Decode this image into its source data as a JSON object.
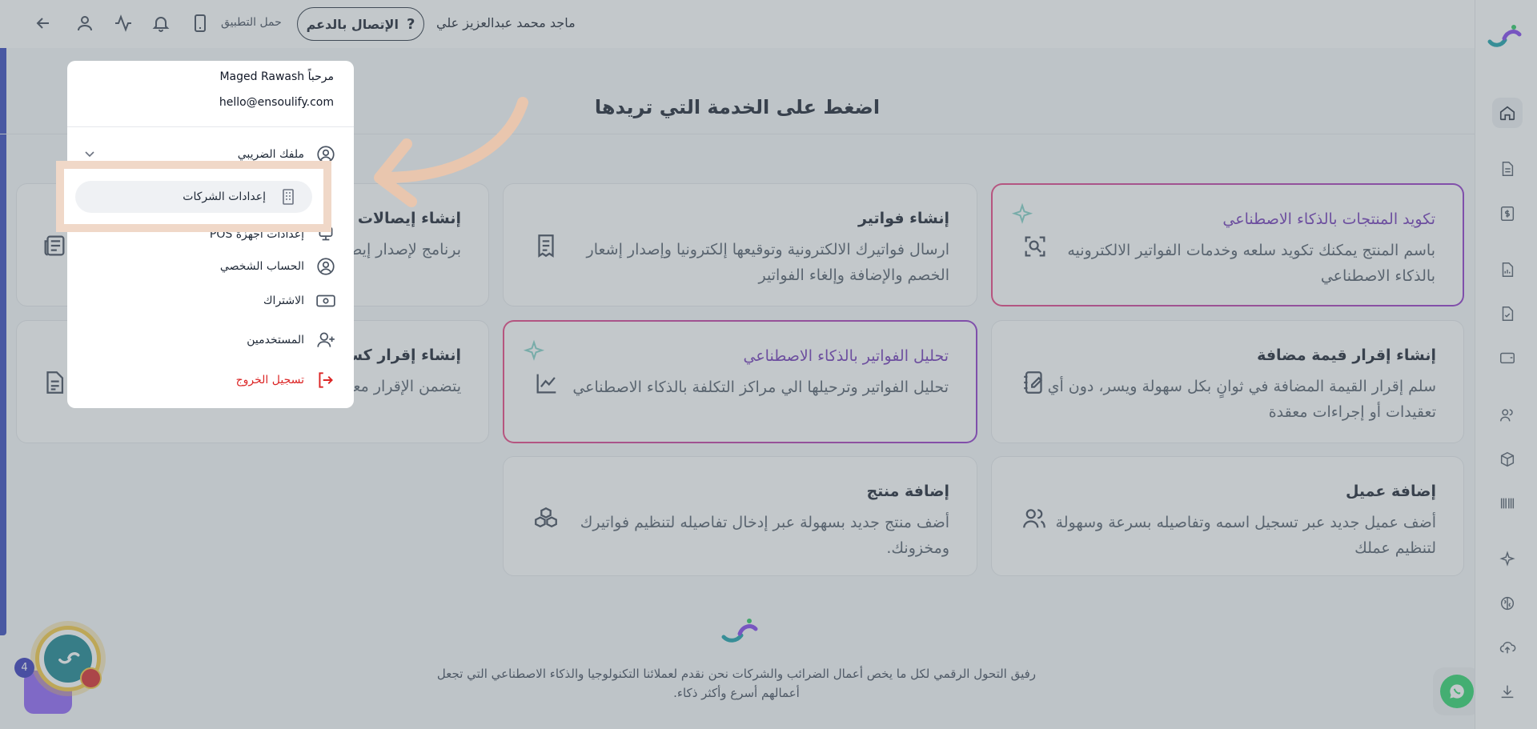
{
  "header": {
    "user_name": "ماجد محمد عبدالعزيز علي",
    "support_label": "الإتصال بالدعم",
    "download_app_label": "حمل التطبيق"
  },
  "page_title": "اضغط على الخدمة التي تريدها",
  "cards": [
    {
      "title": "تكويد المنتجات بالذكاء الاصطناعي",
      "desc": "باسم المنتج يمكنك تكويد سلعه وخدمات الفواتير الالكترونيه بالذكاء الاصطناعي"
    },
    {
      "title": "إنشاء فواتير",
      "desc": "ارسال فواتيرك الالكترونية وتوقيعها إلكترونيا وإصدار إشعار الخصم والإضافة وإلغاء الفواتير"
    },
    {
      "title": "إنشاء إيصالات",
      "desc": "برنامج لإصدار إيصالات عملائك تتبع المدفوعات"
    },
    {
      "title": "إنشاء إقرار قيمة مضافة",
      "desc": "سلم إقرار القيمة المضافة في ثوانٍ بكل سهولة ويسر، دون أي تعقيدات أو إجراءات معقدة"
    },
    {
      "title": "تحليل الفواتير بالذكاء الاصطناعي",
      "desc": "تحليل الفواتير وترحيلها الي مراكز التكلفة بالذكاء الاصطناعي"
    },
    {
      "title": "إنشاء إقرار كسب العمل",
      "desc": "يتضمن الإقرار معلومات كسبه"
    },
    {
      "title": "إضافة عميل",
      "desc": "أضف عميل جديد عبر تسجيل اسمه وتفاصيله بسرعة وسهولة لتنظيم عملك"
    },
    {
      "title": "إضافة منتج",
      "desc": "أضف منتج جديد بسهولة عبر إدخال تفاصيله لتنظيم فواتيرك ومخزونك."
    }
  ],
  "footer": {
    "text": "رفيق التحول الرقمي لكل ما يخص أعمال الضرائب والشركات نحن نقدم لعملائنا التكنولوجيا والذكاء الاصطناعي التي تجعل أعمالهم أسرع وأكثر ذكاء."
  },
  "menu": {
    "greeting": "مرحباً Maged Rawash",
    "email": "hello@ensoulify.com",
    "tax_profile_label": "ملفك الضريبي",
    "companies_settings_label": "إعدادات الشركات",
    "pos_settings_label": "إعدادات أجهزة POS",
    "personal_account_label": "الحساب الشخصي",
    "subscription_label": "الاشتراك",
    "users_label": "المستخدمين",
    "logout_label": "تسجيل الخروج"
  },
  "widgets": {
    "bot_badge": "4"
  },
  "colors": {
    "accent": "#2d3fb8",
    "ai_gradient_start": "#e93a7d",
    "ai_gradient_end": "#8b2fc9",
    "ai_title": "#6b2fb3",
    "logout": "#dc2626",
    "highlight": "#f0d8c8"
  }
}
